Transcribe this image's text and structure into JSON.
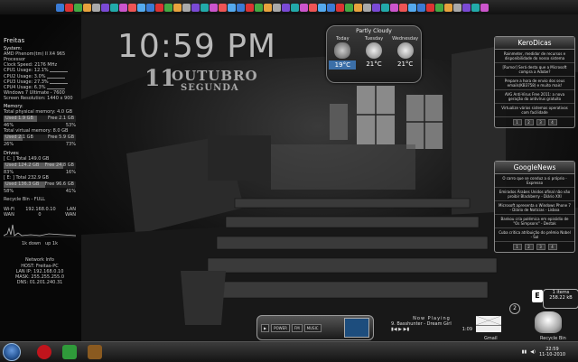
{
  "launcher": {
    "icon_count": 48
  },
  "system": {
    "title": "Freitas",
    "section_label": "System:",
    "processor": "AMD Phenom(tm) II X4 965 Processor",
    "clock_speed": "Clock Speed: 2176 MHz",
    "cpu": [
      {
        "label": "CPU1 Usage:",
        "value": "12.1%"
      },
      {
        "label": "CPU2 Usage:",
        "value": "3.0%"
      },
      {
        "label": "CPU3 Usage:",
        "value": "27.3%"
      },
      {
        "label": "CPU4 Usage:",
        "value": "6.3%"
      }
    ],
    "os": "Windows 7 Ultimate - 7600",
    "resolution": "Screen Resolution: 1440 x 900",
    "memory_label": "Memory:",
    "total_physical": "Total physical memory: 4.0 GB",
    "used_phys": "Used 1.9 GB",
    "free_phys": "Free 2.1 GB",
    "phys_pct": "46%",
    "phys_pct2": "53%",
    "phys_fill": 0.46,
    "total_virtual": "Total virtual memory: 8.0 GB",
    "used_virt": "Used 2.1 GB",
    "free_virt": "Free 5.9 GB",
    "virt_pct": "26%",
    "virt_pct2": "73%",
    "virt_fill": 0.26,
    "drives_label": "Drives:",
    "c_total": "[ C: ] Total 149.0 GB",
    "c_used": "Used 124.2 GB",
    "c_free": "Free 24.8 GB",
    "c_pct": "83%",
    "c_pct2": "16%",
    "c_fill": 0.83,
    "e_total": "[ E: ] Total 232.9 GB",
    "e_used": "Used 136.3 GB",
    "e_free": "Free 96.6 GB",
    "e_pct": "58%",
    "e_pct2": "41%",
    "e_fill": 0.58,
    "recycle": "Recycle Bin - FULL",
    "wifi_label": "Wi-Fi",
    "ip": "192.168.0.10",
    "lan": "LAN",
    "wan_label": "WAN",
    "wan_value": "0",
    "lan2": "WAN",
    "down_label": "1k",
    "up_label": "1k",
    "down": "down",
    "up": "up",
    "netinfo": "Network Info",
    "host": "HOST: Freitas-PC",
    "lanip": "LAN IP: 192.168.0.10",
    "mask": "MASK: 255.255.255.0",
    "dns": "DNS: 01.201.240.31"
  },
  "clock": {
    "time": "10:59 PM",
    "day": "11",
    "month": "OUTUBRO",
    "weekday": "SEGUNDA"
  },
  "weather": {
    "condition": "Partly Cloudy",
    "days": [
      {
        "name": "Today",
        "temp": "19°C"
      },
      {
        "name": "Tuesday",
        "temp": "21°C"
      },
      {
        "name": "Wednesday",
        "temp": "21°C"
      }
    ]
  },
  "kerodicas": {
    "title": "KeroDicas",
    "items": [
      "Rainmeter, medidor de recursos e disponibilidade do nosso sistema",
      "[Rumor] Será desta que a Microsoft compra a Adobe?",
      "Prepare a hora de envio dos seus emails(KB3758) e muito mais!",
      "AVG Anti-Virus Free 2011: a nova geração do antivírus gratuito",
      "Virtualize vários sistemas operativos com facilidade"
    ],
    "pages": [
      "1",
      "2",
      "3",
      "4"
    ]
  },
  "googlenews": {
    "title": "GoogleNews",
    "items": [
      "O carro que se conduz a si próprio - Expresso",
      "Emirados Árabes Unidos afinal não vão proibir Blackberry - Diário XXI",
      "Microsoft apresenta o Windows Phone 7 - Diário de Notícias - Lisboa",
      "Bankou cria polémica em episódio de \"Os Simpsons\" - Destak",
      "Cuba critica atribuição do prémio Nobel - Sol"
    ],
    "pages": [
      "1",
      "2",
      "3",
      "4"
    ]
  },
  "media": {
    "buttons": [
      "POWER",
      "FM",
      "MUSIC"
    ],
    "now_playing_label": "Now Playing",
    "track": "9. Basshunter - Dream Girl",
    "elapsed": "1:09"
  },
  "gmail_label": "Gmail",
  "gmail_count": "2",
  "recycle": {
    "items": "1 items",
    "size": "258.22 kB",
    "label": "Recycle Bin",
    "badge": "E"
  },
  "taskbar": {
    "time": "22:59",
    "date": "11-10-2010"
  }
}
